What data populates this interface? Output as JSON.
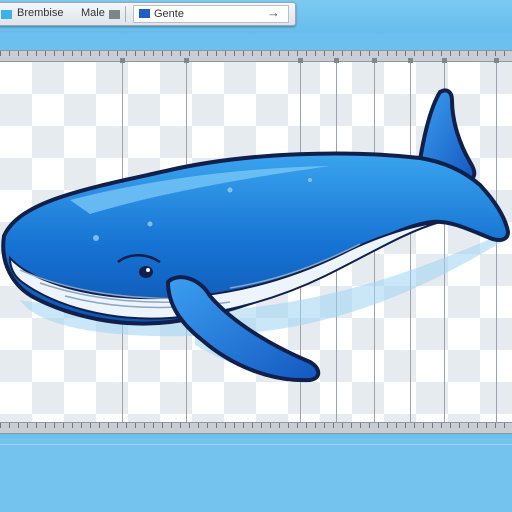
{
  "toolbar": {
    "label1": "Brembise",
    "label2": "Male",
    "field_value": "Gente",
    "go_icon": "arrow-right-icon"
  },
  "colors": {
    "background": "#6cc0ee",
    "whale_body": "#1a78d4",
    "whale_outline": "#10204a",
    "accent": "#0d5fc0"
  }
}
